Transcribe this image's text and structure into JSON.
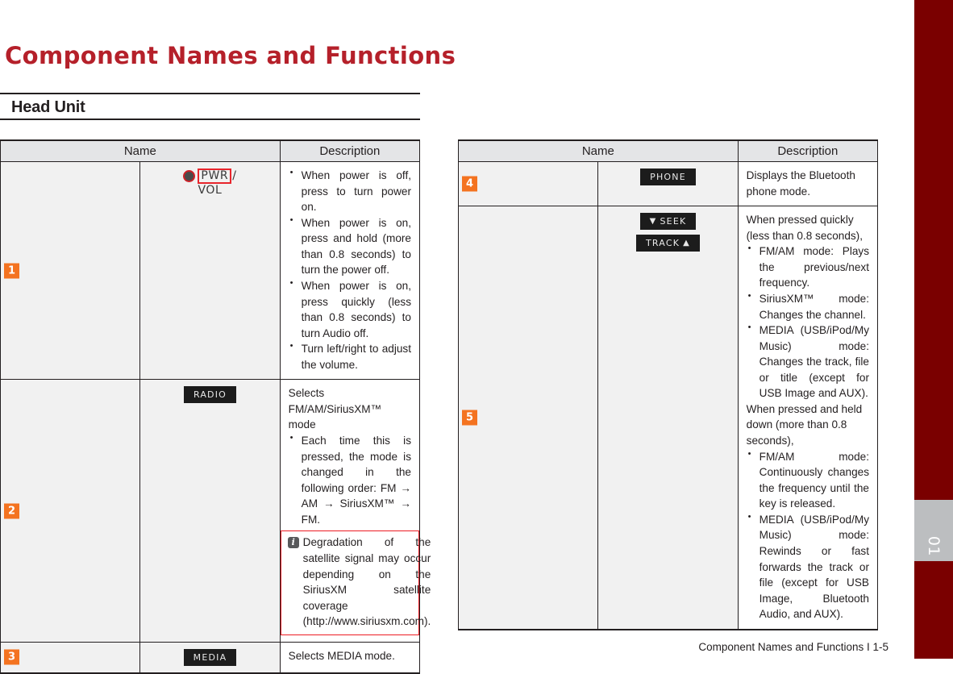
{
  "page": {
    "title": "Component Names and Functions",
    "section_heading": "Head Unit",
    "footer": "Component Names and Functions I 1-5",
    "chapter_tab_number": "01",
    "accent_red": "#b5202a",
    "edge_band_color": "#7a0000",
    "badge_orange": "#f47320",
    "note_border_red": "#ed1c24"
  },
  "left_table": {
    "headers": {
      "name": "Name",
      "description": "Description"
    },
    "rows": [
      {
        "num": "1",
        "key": {
          "type": "knob",
          "dot": "power-dot",
          "boxed_label": "PWR",
          "slash": "/",
          "second_label": "VOL"
        },
        "lead": "",
        "bullets": [
          "When power is off, press to turn power on.",
          "When power is on, press and hold (more than 0.8 seconds) to turn the power off.",
          "When power is on, press quickly (less than 0.8 seconds) to turn Audio off.",
          "Turn left/right to adjust the volume."
        ],
        "note": null
      },
      {
        "num": "2",
        "key": {
          "type": "cap",
          "label": "RADIO"
        },
        "lead": "Selects FM/AM/SiriusXM™ mode",
        "bullets": [
          "Each time this is pressed, the mode is changed in the following order: FM → AM → SiriusXM™ → FM."
        ],
        "note": "Degradation of the satellite signal may occur depending on the SiriusXM satellite coverage (http://www.siriusxm.com)."
      },
      {
        "num": "3",
        "key": {
          "type": "cap",
          "label": "MEDIA"
        },
        "lead": "Selects MEDIA mode.",
        "bullets": [],
        "note": null
      }
    ]
  },
  "right_table": {
    "headers": {
      "name": "Name",
      "description": "Description"
    },
    "rows": [
      {
        "num": "4",
        "key": {
          "type": "cap",
          "label": "PHONE"
        },
        "lead": "Displays the Bluetooth phone mode.",
        "bullets": [],
        "lead2": "",
        "bullets2": []
      },
      {
        "num": "5",
        "key": {
          "type": "seek-track",
          "seek_label": "SEEK",
          "seek_icon": "chevron-down-icon",
          "track_label": "TRACK",
          "track_icon": "chevron-up-icon"
        },
        "lead": "When pressed quickly (less than 0.8 seconds),",
        "bullets": [
          "FM/AM mode: Plays the previous/next frequency.",
          "SiriusXM™ mode: Changes the channel.",
          "MEDIA (USB/iPod/My Music) mode: Changes the track, file or title (except for USB Image and AUX)."
        ],
        "lead2": "When pressed and held down (more than 0.8 seconds),",
        "bullets2": [
          "FM/AM mode: Continuously changes the frequency until the key is released.",
          "MEDIA (USB/iPod/My Music) mode: Rewinds or fast forwards the track or file (except for USB Image, Bluetooth Audio, and AUX)."
        ]
      }
    ]
  }
}
